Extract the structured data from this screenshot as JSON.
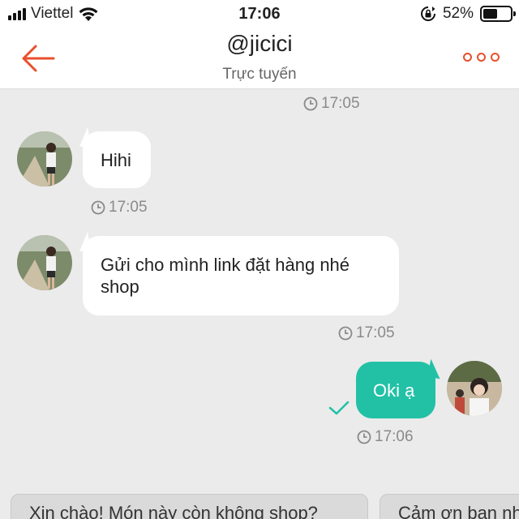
{
  "status_bar": {
    "carrier": "Viettel",
    "time": "17:06",
    "battery": "52%",
    "battery_level": 0.52
  },
  "header": {
    "title": "@jicici",
    "subtitle": "Trực tuyến"
  },
  "messages": [
    {
      "side": "in",
      "text": "Hihi",
      "time": "17:05"
    },
    {
      "side": "in",
      "text": "Gửi cho mình link đặt hàng nhé shop",
      "time": "17:05"
    },
    {
      "side": "out",
      "text": "Oki ạ",
      "time": "17:06"
    }
  ],
  "top_timestamp": "17:05",
  "quick_replies": [
    "Xin chào! Món này còn không shop?",
    "Cảm ơn bạn nhé"
  ],
  "colors": {
    "accent": "#e8502d",
    "outgoing_bubble": "#22c1a6",
    "background": "#ebebeb"
  },
  "icons": {
    "back": "arrow-left-icon",
    "more": "more-dots-icon",
    "clock": "clock-icon",
    "sent": "checkmark-icon"
  }
}
